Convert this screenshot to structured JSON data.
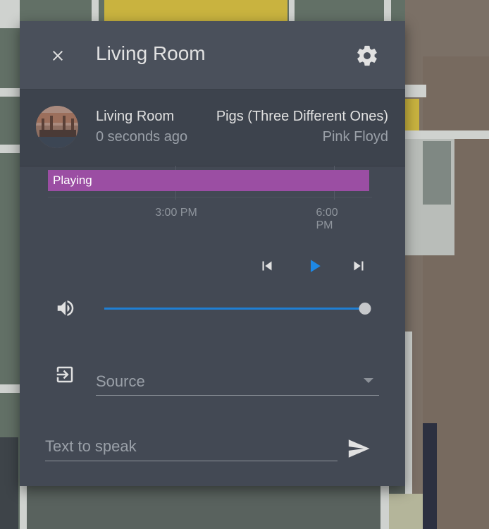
{
  "dialog": {
    "title": "Living Room",
    "close_icon": "close-icon",
    "settings_icon": "gear-icon"
  },
  "entity": {
    "name": "Living Room",
    "last_changed": "0 seconds ago",
    "media_title": "Pigs (Three Different Ones)",
    "media_artist": "Pink Floyd"
  },
  "timeline": {
    "state_label": "Playing",
    "state_color": "#9b4ea3",
    "ticks": [
      "3:00 PM",
      "6:00 PM"
    ]
  },
  "controls": {
    "previous_icon": "skip-previous-icon",
    "play_icon": "play-icon",
    "next_icon": "skip-next-icon",
    "play_color": "#1e88e5"
  },
  "volume": {
    "icon": "volume-high-icon",
    "level": 1.0,
    "accent": "#1f7fd4"
  },
  "source": {
    "icon": "input-source-icon",
    "label": "Source"
  },
  "tts": {
    "placeholder": "Text to speak",
    "send_icon": "send-icon"
  }
}
